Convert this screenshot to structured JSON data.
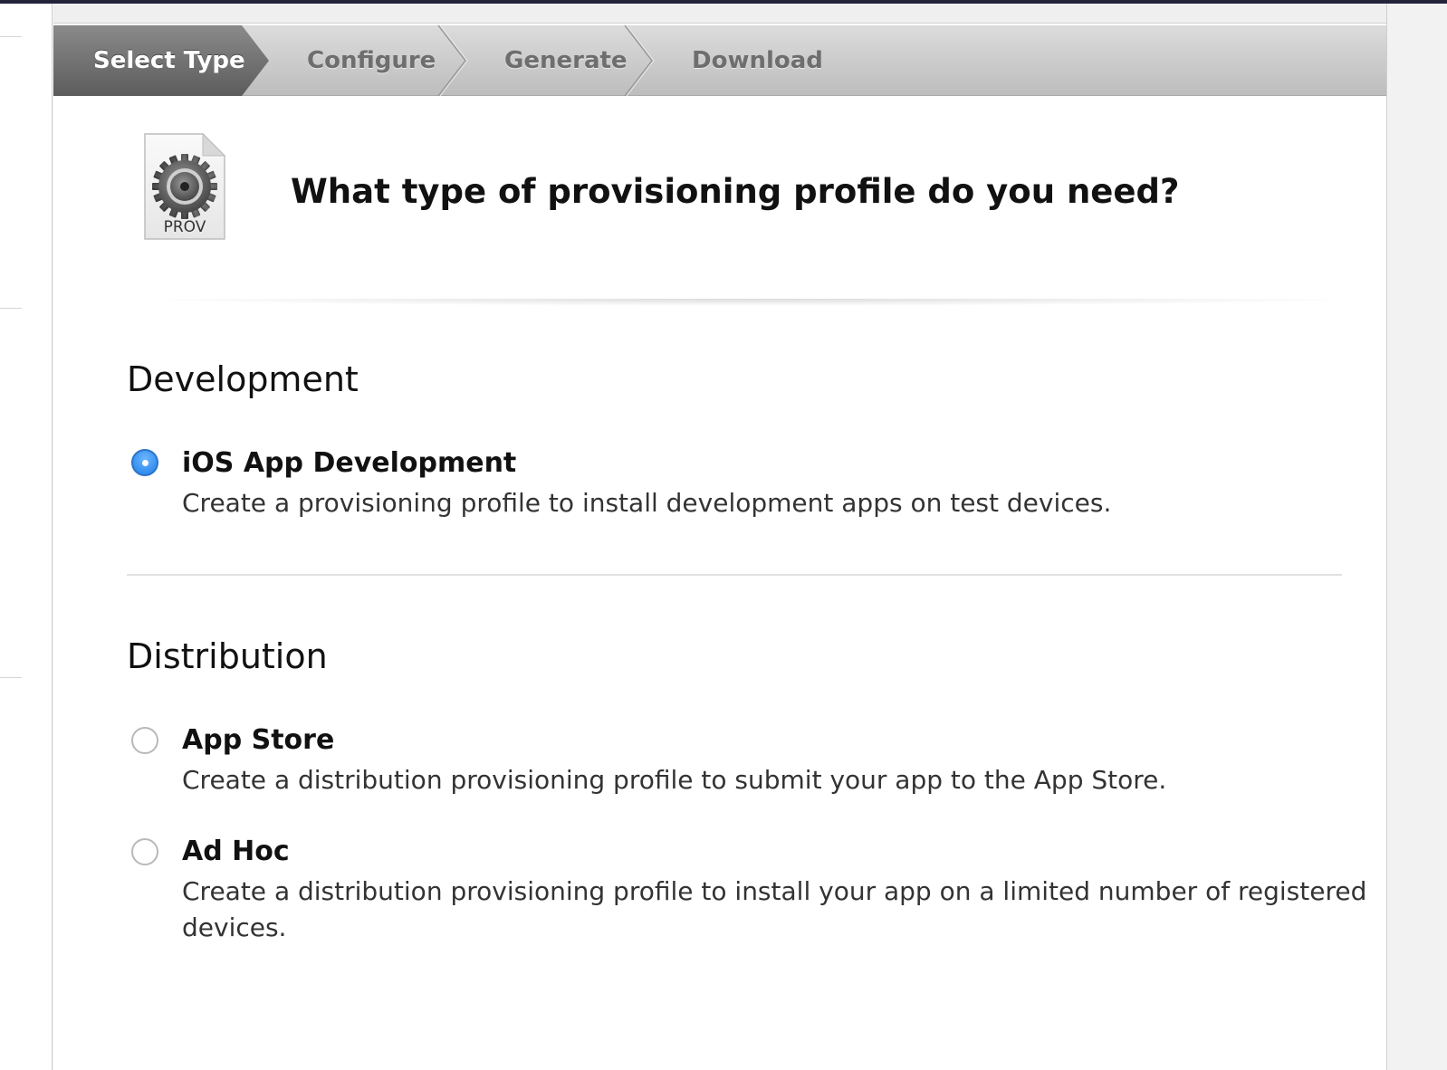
{
  "wizard": {
    "steps": [
      {
        "label": "Select Type",
        "active": true
      },
      {
        "label": "Configure",
        "active": false
      },
      {
        "label": "Generate",
        "active": false
      },
      {
        "label": "Download",
        "active": false
      }
    ]
  },
  "header": {
    "icon_label": "PROV",
    "question": "What type of provisioning profile do you need?"
  },
  "sections": {
    "development": {
      "title": "Development",
      "options": [
        {
          "title": "iOS App Development",
          "description": "Create a provisioning profile to install development apps on test devices.",
          "selected": true
        }
      ]
    },
    "distribution": {
      "title": "Distribution",
      "options": [
        {
          "title": "App Store",
          "description": "Create a distribution provisioning profile to submit your app to the App Store.",
          "selected": false
        },
        {
          "title": "Ad Hoc",
          "description": "Create a distribution provisioning profile to install your app on a limited number of registered devices.",
          "selected": false
        }
      ]
    }
  },
  "colors": {
    "radio_selected": "#1f7fe8",
    "active_step": "#686868",
    "inactive_step_text": "#6e6e6e"
  }
}
